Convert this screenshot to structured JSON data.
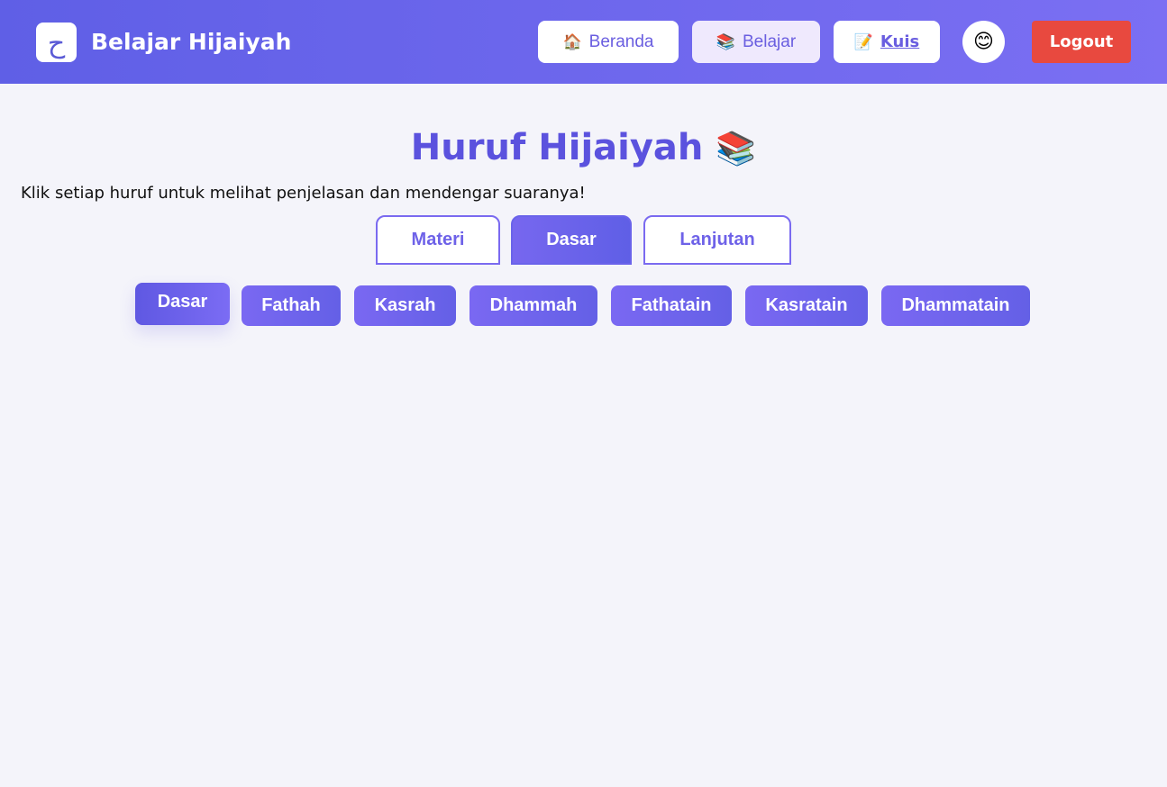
{
  "header": {
    "logo_glyph": "ح",
    "brand": "Belajar Hijaiyah",
    "nav": [
      {
        "icon": "🏠",
        "icon_name": "house-icon",
        "label": "Beranda"
      },
      {
        "icon": "📚",
        "icon_name": "books-icon",
        "label": "Belajar"
      },
      {
        "icon": "📝",
        "icon_name": "memo-icon",
        "label": "Kuis"
      }
    ],
    "avatar": "😊",
    "logout": "Logout"
  },
  "main": {
    "title": "Huruf Hijaiyah",
    "title_icon": "📚",
    "subtitle": "Klik setiap huruf untuk melihat penjelasan dan mendengar suaranya!",
    "tabs": [
      {
        "label": "Materi",
        "active": false
      },
      {
        "label": "Dasar",
        "active": true
      },
      {
        "label": "Lanjutan",
        "active": false
      }
    ],
    "categories": [
      {
        "label": "Dasar",
        "active": true
      },
      {
        "label": "Fathah",
        "active": false
      },
      {
        "label": "Kasrah",
        "active": false
      },
      {
        "label": "Dhammah",
        "active": false
      },
      {
        "label": "Fathatain",
        "active": false
      },
      {
        "label": "Kasratain",
        "active": false
      },
      {
        "label": "Dhammatain",
        "active": false
      }
    ]
  },
  "colors": {
    "header_gradient_start": "#5f5fe6",
    "header_gradient_end": "#7b6ff3",
    "accent": "#5b52de",
    "logout": "#e8493f",
    "page_background": "#f4f4fa"
  }
}
